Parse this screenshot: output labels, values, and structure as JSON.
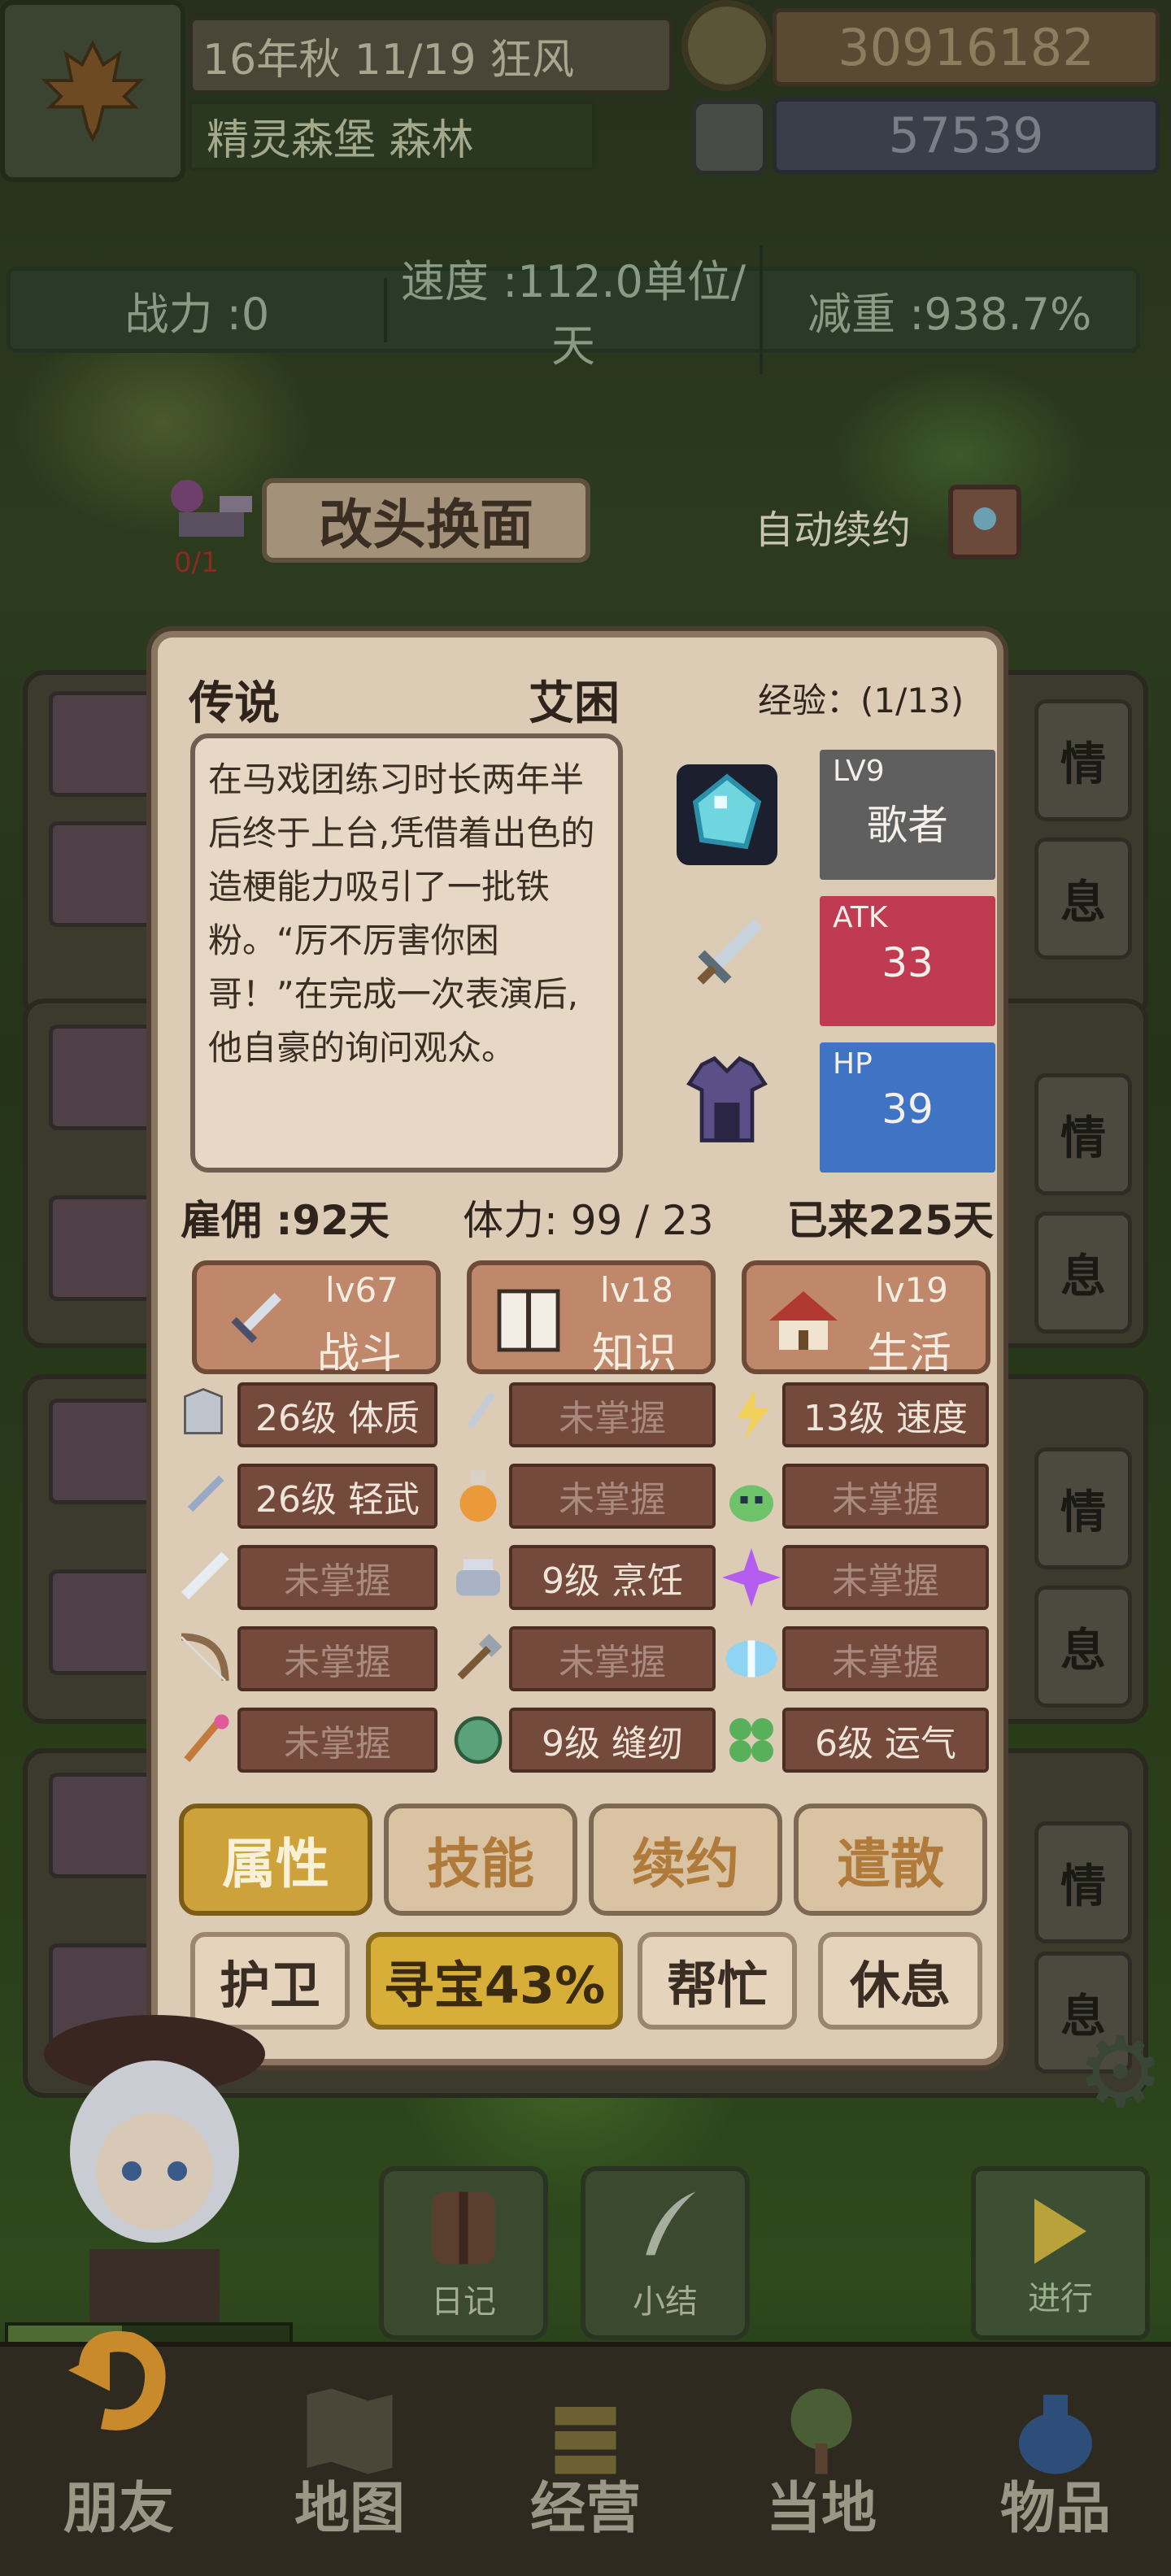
{
  "header": {
    "date": "16年秋 11/19 狂风",
    "location": "精灵森堡 森林",
    "coins": "30916182",
    "gems": "57539"
  },
  "stats_bar": {
    "power": "战力 :0",
    "speed": "速度 :112.0单位/天",
    "weight": "减重 :938.7%"
  },
  "quest": {
    "lamp_count": "0/1",
    "change_face_label": "改头换面",
    "auto_renew_label": "自动续约"
  },
  "background_tabs": [
    "情",
    "息",
    "情",
    "息",
    "情",
    "息",
    "情",
    "息"
  ],
  "character_card": {
    "rarity": "传说",
    "name": "艾困",
    "exp": "经验：(1/13)",
    "description": "在马戏团练习时长两年半后终于上台,凭借着出色的造梗能力吸引了一批铁粉。“厉不厉害你困哥！”在完成一次表演后,他自豪的询问观众。",
    "job": {
      "level": "LV9",
      "name": "歌者",
      "color": "#5f5f5f"
    },
    "atk": {
      "label": "ATK",
      "value": "33",
      "color": "#c03a52"
    },
    "hp": {
      "label": "HP",
      "value": "39",
      "color": "#3f74c4"
    },
    "hire": "雇佣 :92天",
    "stamina": "体力: 99 / 23",
    "days_here": "已来225天",
    "categories": [
      {
        "level": "lv67",
        "name": "战斗",
        "icon": "sword-icon"
      },
      {
        "level": "lv18",
        "name": "知识",
        "icon": "book-icon"
      },
      {
        "level": "lv19",
        "name": "生活",
        "icon": "house-icon"
      }
    ],
    "skills": [
      [
        {
          "icon": "armor-icon",
          "label": "26级 体质",
          "learned": true
        },
        {
          "icon": "dagger-icon",
          "label": "未掌握",
          "learned": false
        },
        {
          "icon": "lightning-icon",
          "label": "13级 速度",
          "learned": true
        }
      ],
      [
        {
          "icon": "light-sword-icon",
          "label": "26级 轻武",
          "learned": true
        },
        {
          "icon": "potion-icon",
          "label": "未掌握",
          "learned": false
        },
        {
          "icon": "slime-icon",
          "label": "未掌握",
          "learned": false
        }
      ],
      [
        {
          "icon": "blade-icon",
          "label": "未掌握",
          "learned": false
        },
        {
          "icon": "cooking-pot-icon",
          "label": "9级 烹饪",
          "learned": true
        },
        {
          "icon": "sparkle-icon",
          "label": "未掌握",
          "learned": false
        }
      ],
      [
        {
          "icon": "bow-icon",
          "label": "未掌握",
          "learned": false
        },
        {
          "icon": "hammer-icon",
          "label": "未掌握",
          "learned": false
        },
        {
          "icon": "crystal-icon",
          "label": "未掌握",
          "learned": false
        }
      ],
      [
        {
          "icon": "magic-wand-icon",
          "label": "未掌握",
          "learned": false
        },
        {
          "icon": "yarn-icon",
          "label": "9级 缝纫",
          "learned": true
        },
        {
          "icon": "clover-icon",
          "label": "6级 运气",
          "learned": true
        }
      ]
    ],
    "tabs": [
      "属性",
      "技能",
      "续约",
      "遣散"
    ],
    "active_tab": "属性",
    "actions": [
      "护卫",
      "寻宝43%",
      "帮忙",
      "休息"
    ],
    "active_action": "寻宝43%"
  },
  "quick_buttons": {
    "diary": "日记",
    "summary": "小结",
    "proceed": "进行"
  },
  "nav": [
    "朋友",
    "地图",
    "经营",
    "当地",
    "物品"
  ]
}
